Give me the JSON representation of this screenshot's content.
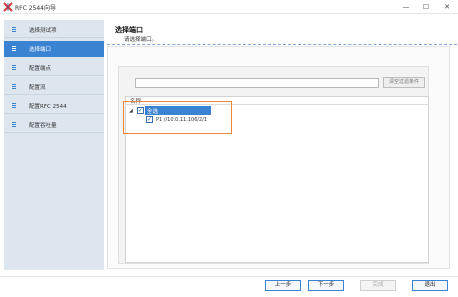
{
  "window": {
    "title": "RFC 2544向导",
    "icon": "app-x-icon",
    "minimize_glyph": "—",
    "maximize_glyph": "☐",
    "close_glyph": "✕"
  },
  "sidebar": {
    "items": [
      {
        "label": "选择测试项",
        "icon": "list-icon",
        "active": false
      },
      {
        "label": "选择端口",
        "icon": "list-icon",
        "active": true
      },
      {
        "label": "配置端点",
        "icon": "list-icon",
        "active": false
      },
      {
        "label": "配置流",
        "icon": "list-icon",
        "active": false
      },
      {
        "label": "配置RFC 2544",
        "icon": "list-icon",
        "active": false
      },
      {
        "label": "配置吞吐量",
        "icon": "list-icon",
        "active": false
      }
    ]
  },
  "header": {
    "title": "选择端口",
    "subtitle": "请选择端口。"
  },
  "filter": {
    "value": "",
    "placeholder": "",
    "clear_label": "清空过滤条件"
  },
  "tree": {
    "column_header": "名称",
    "expander_glyph": "◢",
    "root": {
      "label": "全选",
      "checked": true,
      "selected": true
    },
    "children": [
      {
        "label": "P1 //10.0.11.106/2/1",
        "checked": true
      }
    ],
    "check_glyph": "✓"
  },
  "footer": {
    "prev_label": "上一步",
    "next_label": "下一步",
    "finish_label": "完成",
    "exit_label": "退出"
  },
  "colors": {
    "accent": "#3a82d2",
    "sidebar_bg": "#dde6ef",
    "highlight": "#f0883a"
  }
}
